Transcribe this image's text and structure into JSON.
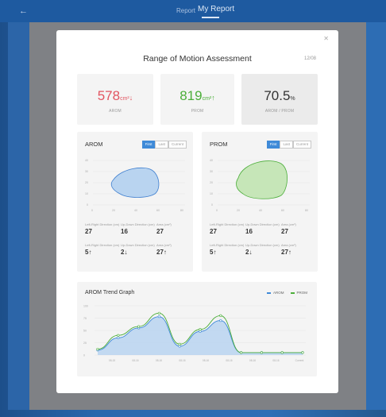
{
  "header": {
    "back_icon": "back-arrow-icon",
    "tab_report": "Report",
    "tab_my_report": "My Report"
  },
  "modal": {
    "title": "Range of Motion Assessment",
    "date": "12/08",
    "close_icon": "close-icon"
  },
  "stats": {
    "arom": {
      "value": "578",
      "unit": "cm²",
      "arrow": "↓",
      "label": "AROM",
      "color": "#e25561"
    },
    "prom": {
      "value": "819",
      "unit": "cm²",
      "arrow": "↑",
      "label": "PROM",
      "color": "#4cae3a"
    },
    "ratio": {
      "value": "70.5",
      "unit": "%",
      "label": "AROM / PROM"
    }
  },
  "arom_panel": {
    "title": "AROM",
    "segments": [
      "First",
      "Last",
      "Current"
    ],
    "active_segment": "First",
    "y_ticks": [
      "40",
      "30",
      "20",
      "10",
      "0"
    ],
    "x_ticks": [
      "0",
      "20",
      "40",
      "60",
      "80"
    ],
    "metric_labels": [
      "Left-Right Direction (cm)",
      "Up-Down Direction (cm)",
      "Area (cm²)"
    ],
    "row1": [
      "27",
      "16",
      "27"
    ],
    "row2": [
      "5↑",
      "2↓",
      "27↑"
    ]
  },
  "prom_panel": {
    "title": "PROM",
    "segments": [
      "First",
      "Last",
      "Current"
    ],
    "active_segment": "First",
    "y_ticks": [
      "40",
      "30",
      "20",
      "10",
      "0"
    ],
    "x_ticks": [
      "0",
      "20",
      "40",
      "60",
      "80"
    ],
    "metric_labels": [
      "Left-Right Direction (cm)",
      "Up-Down Direction (cm)",
      "Area (cm²)"
    ],
    "row1": [
      "27",
      "16",
      "27"
    ],
    "row2": [
      "5↑",
      "2↓",
      "27↑"
    ]
  },
  "trend": {
    "title": "AROM Trend Graph",
    "legend": [
      "AROM",
      "PROM"
    ],
    "colors": {
      "arom": "#3f8ad8",
      "prom": "#4cae3a",
      "fill": "#b9d4f0"
    }
  },
  "chart_data": {
    "type": "area",
    "title": "AROM Trend Graph",
    "categories": [
      "08-15",
      "08-16",
      "08-16",
      "08-16",
      "08-16",
      "08-16",
      "08-16",
      "08-16",
      "Current"
    ],
    "y_ticks": [
      "100",
      "75",
      "50",
      "25",
      "0"
    ],
    "ylim": [
      0,
      100
    ],
    "series": [
      {
        "name": "AROM",
        "values": [
          10,
          35,
          55,
          78,
          18,
          48,
          70,
          5,
          5,
          5,
          5
        ]
      },
      {
        "name": "PROM",
        "values": [
          12,
          40,
          58,
          85,
          22,
          52,
          80,
          5,
          5,
          5,
          5
        ]
      }
    ],
    "legend": "top-right"
  }
}
